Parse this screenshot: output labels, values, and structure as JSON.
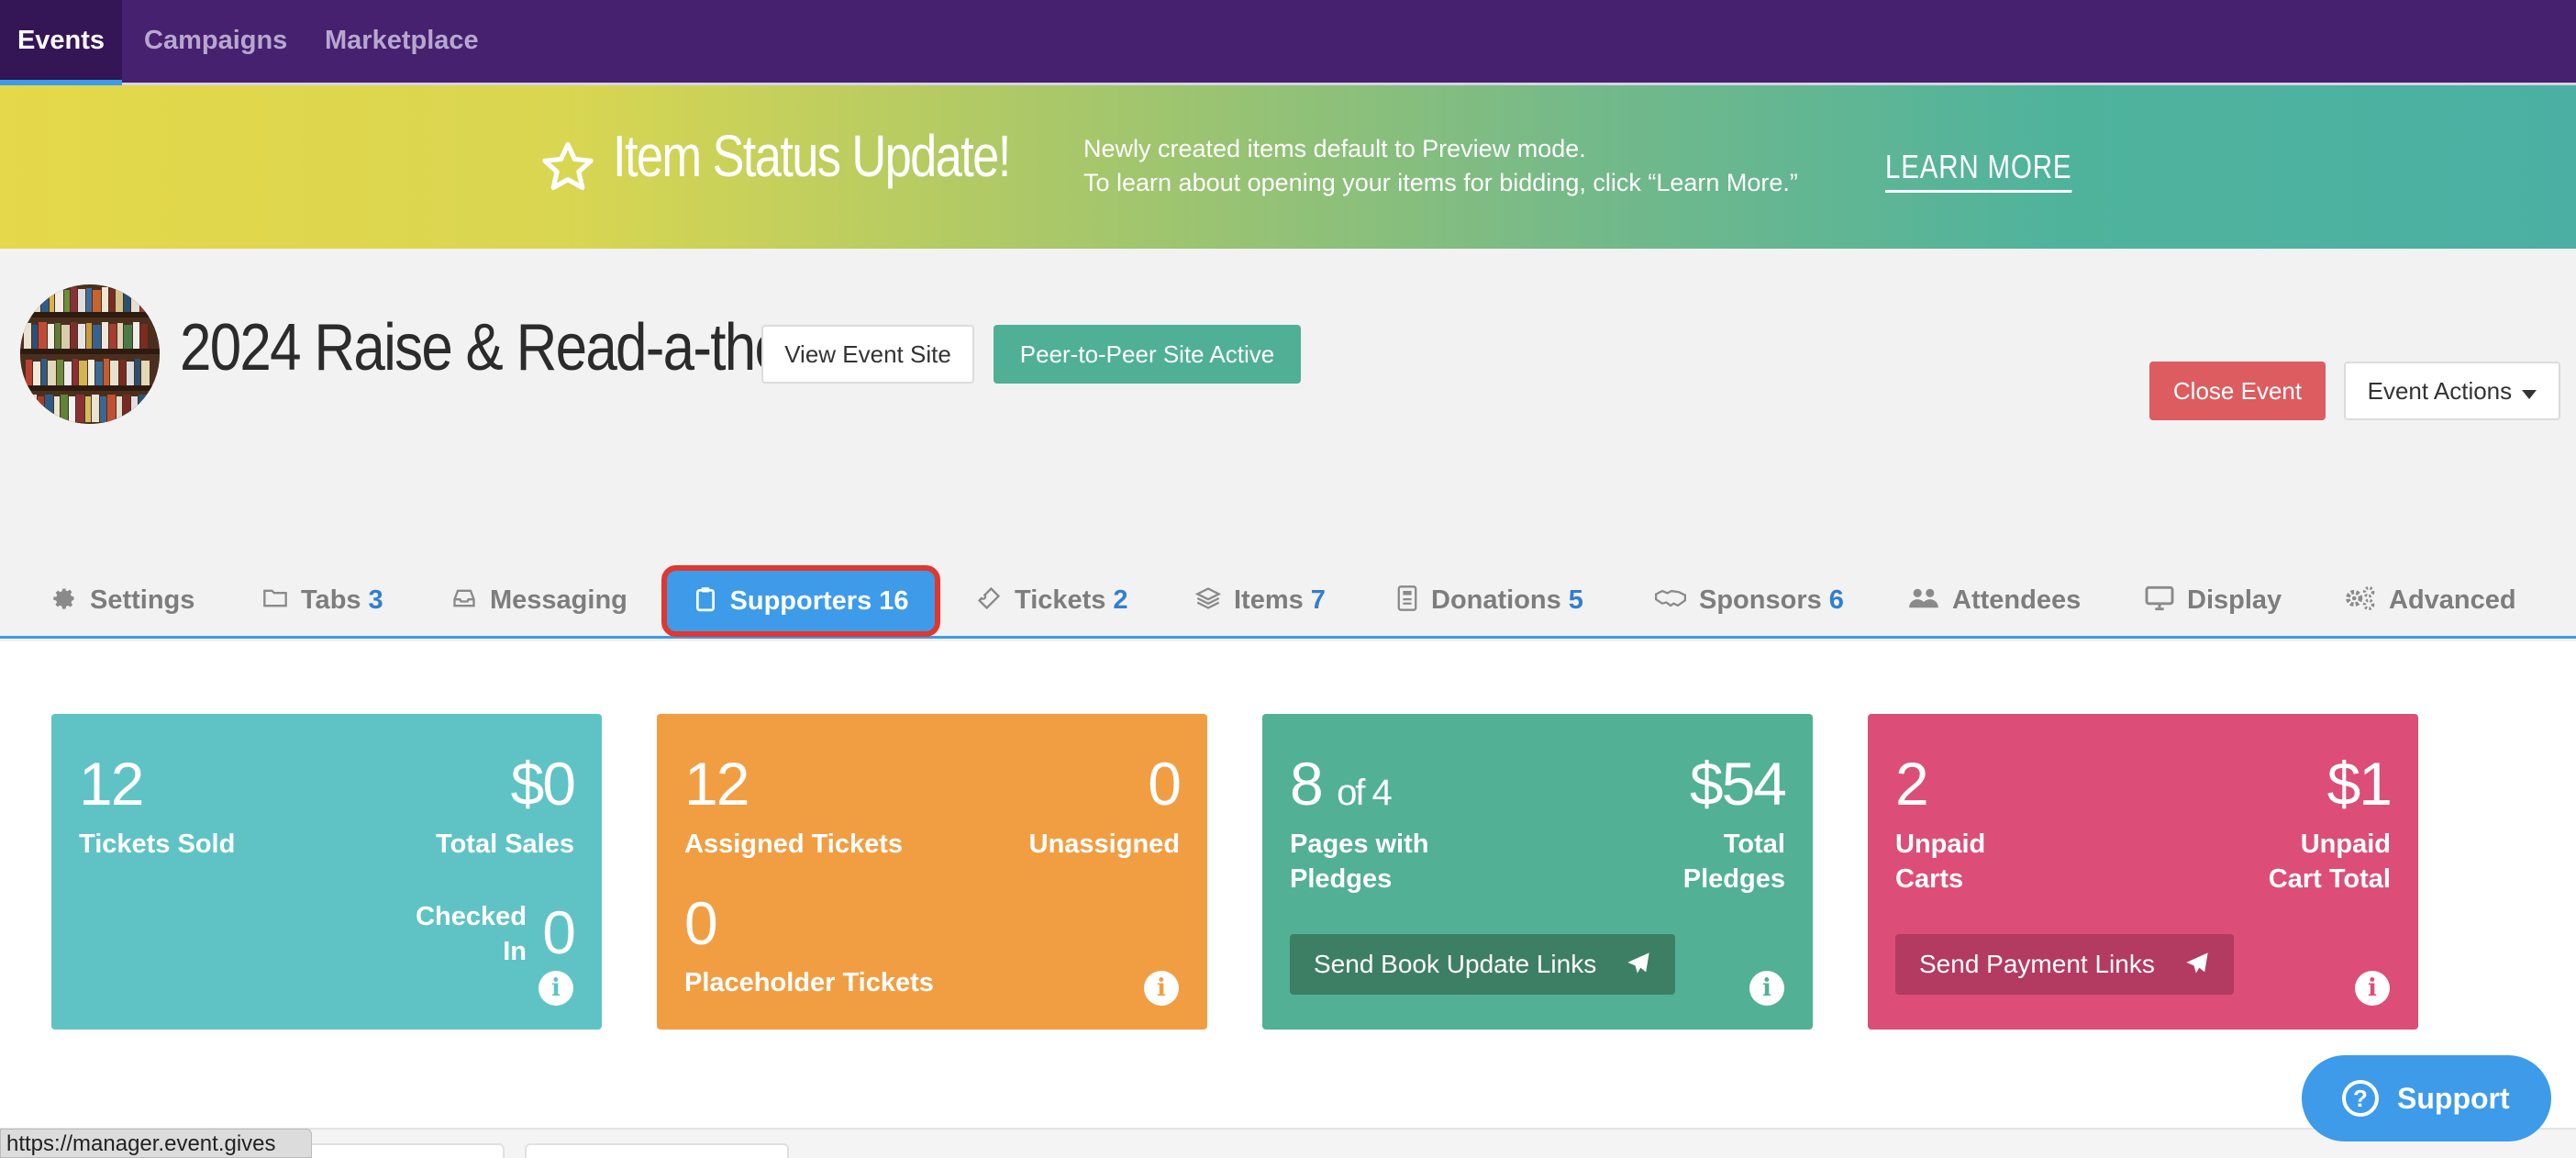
{
  "topnav": {
    "items": [
      {
        "label": "Events",
        "active": true
      },
      {
        "label": "Campaigns",
        "active": false
      },
      {
        "label": "Marketplace",
        "active": false
      }
    ]
  },
  "banner": {
    "icon": "star-outline-icon",
    "title": "Item Status Update!",
    "line1": "Newly created items default to Preview mode.",
    "line2": "To learn about opening your items for bidding, click “Learn More.”",
    "learn_more": "LEARN MORE"
  },
  "event": {
    "title": "2024 Raise & Read-a-thon",
    "view_site_label": "View Event Site",
    "p2p_label": "Peer-to-Peer Site Active",
    "close_label": "Close Event",
    "actions_label": "Event Actions"
  },
  "tabs": [
    {
      "label": "Settings",
      "count": "",
      "icon": "gear-icon"
    },
    {
      "label": "Tabs",
      "count": "3",
      "icon": "folder-icon"
    },
    {
      "label": "Messaging",
      "count": "",
      "icon": "inbox-icon"
    },
    {
      "label": "Supporters",
      "count": "16",
      "icon": "clipboard-icon",
      "active": true
    },
    {
      "label": "Tickets",
      "count": "2",
      "icon": "ticket-icon"
    },
    {
      "label": "Items",
      "count": "7",
      "icon": "layers-icon"
    },
    {
      "label": "Donations",
      "count": "5",
      "icon": "receipt-icon"
    },
    {
      "label": "Sponsors",
      "count": "6",
      "icon": "handshake-icon"
    },
    {
      "label": "Attendees",
      "count": "",
      "icon": "users-icon"
    },
    {
      "label": "Display",
      "count": "",
      "icon": "monitor-icon"
    },
    {
      "label": "Advanced",
      "count": "",
      "icon": "gears-icon"
    }
  ],
  "cards": {
    "tickets": {
      "color": "#5fc3c5",
      "sold_value": "12",
      "sold_label": "Tickets Sold",
      "sales_value": "$0",
      "sales_label": "Total Sales",
      "checked_label_1": "Checked",
      "checked_label_2": "In",
      "checked_value": "0"
    },
    "assigned": {
      "color": "#f19e43",
      "assigned_value": "12",
      "assigned_label": "Assigned Tickets",
      "unassigned_value": "0",
      "unassigned_label": "Unassigned",
      "placeholder_value": "0",
      "placeholder_label": "Placeholder Tickets"
    },
    "pledges": {
      "color": "#52b094",
      "pages_value": "8",
      "pages_of": "of 4",
      "pages_label_1": "Pages with",
      "pages_label_2": "Pledges",
      "total_value": "$54",
      "total_label_1": "Total",
      "total_label_2": "Pledges",
      "button_label": "Send Book Update Links"
    },
    "carts": {
      "color": "#dc4e77",
      "unpaid_value": "2",
      "unpaid_label_1": "Unpaid",
      "unpaid_label_2": "Carts",
      "total_value": "$1",
      "total_label_1": "Unpaid",
      "total_label_2": "Cart Total",
      "button_label": "Send Payment Links"
    }
  },
  "support_label": "Support",
  "status_url": "https://manager.event.gives"
}
